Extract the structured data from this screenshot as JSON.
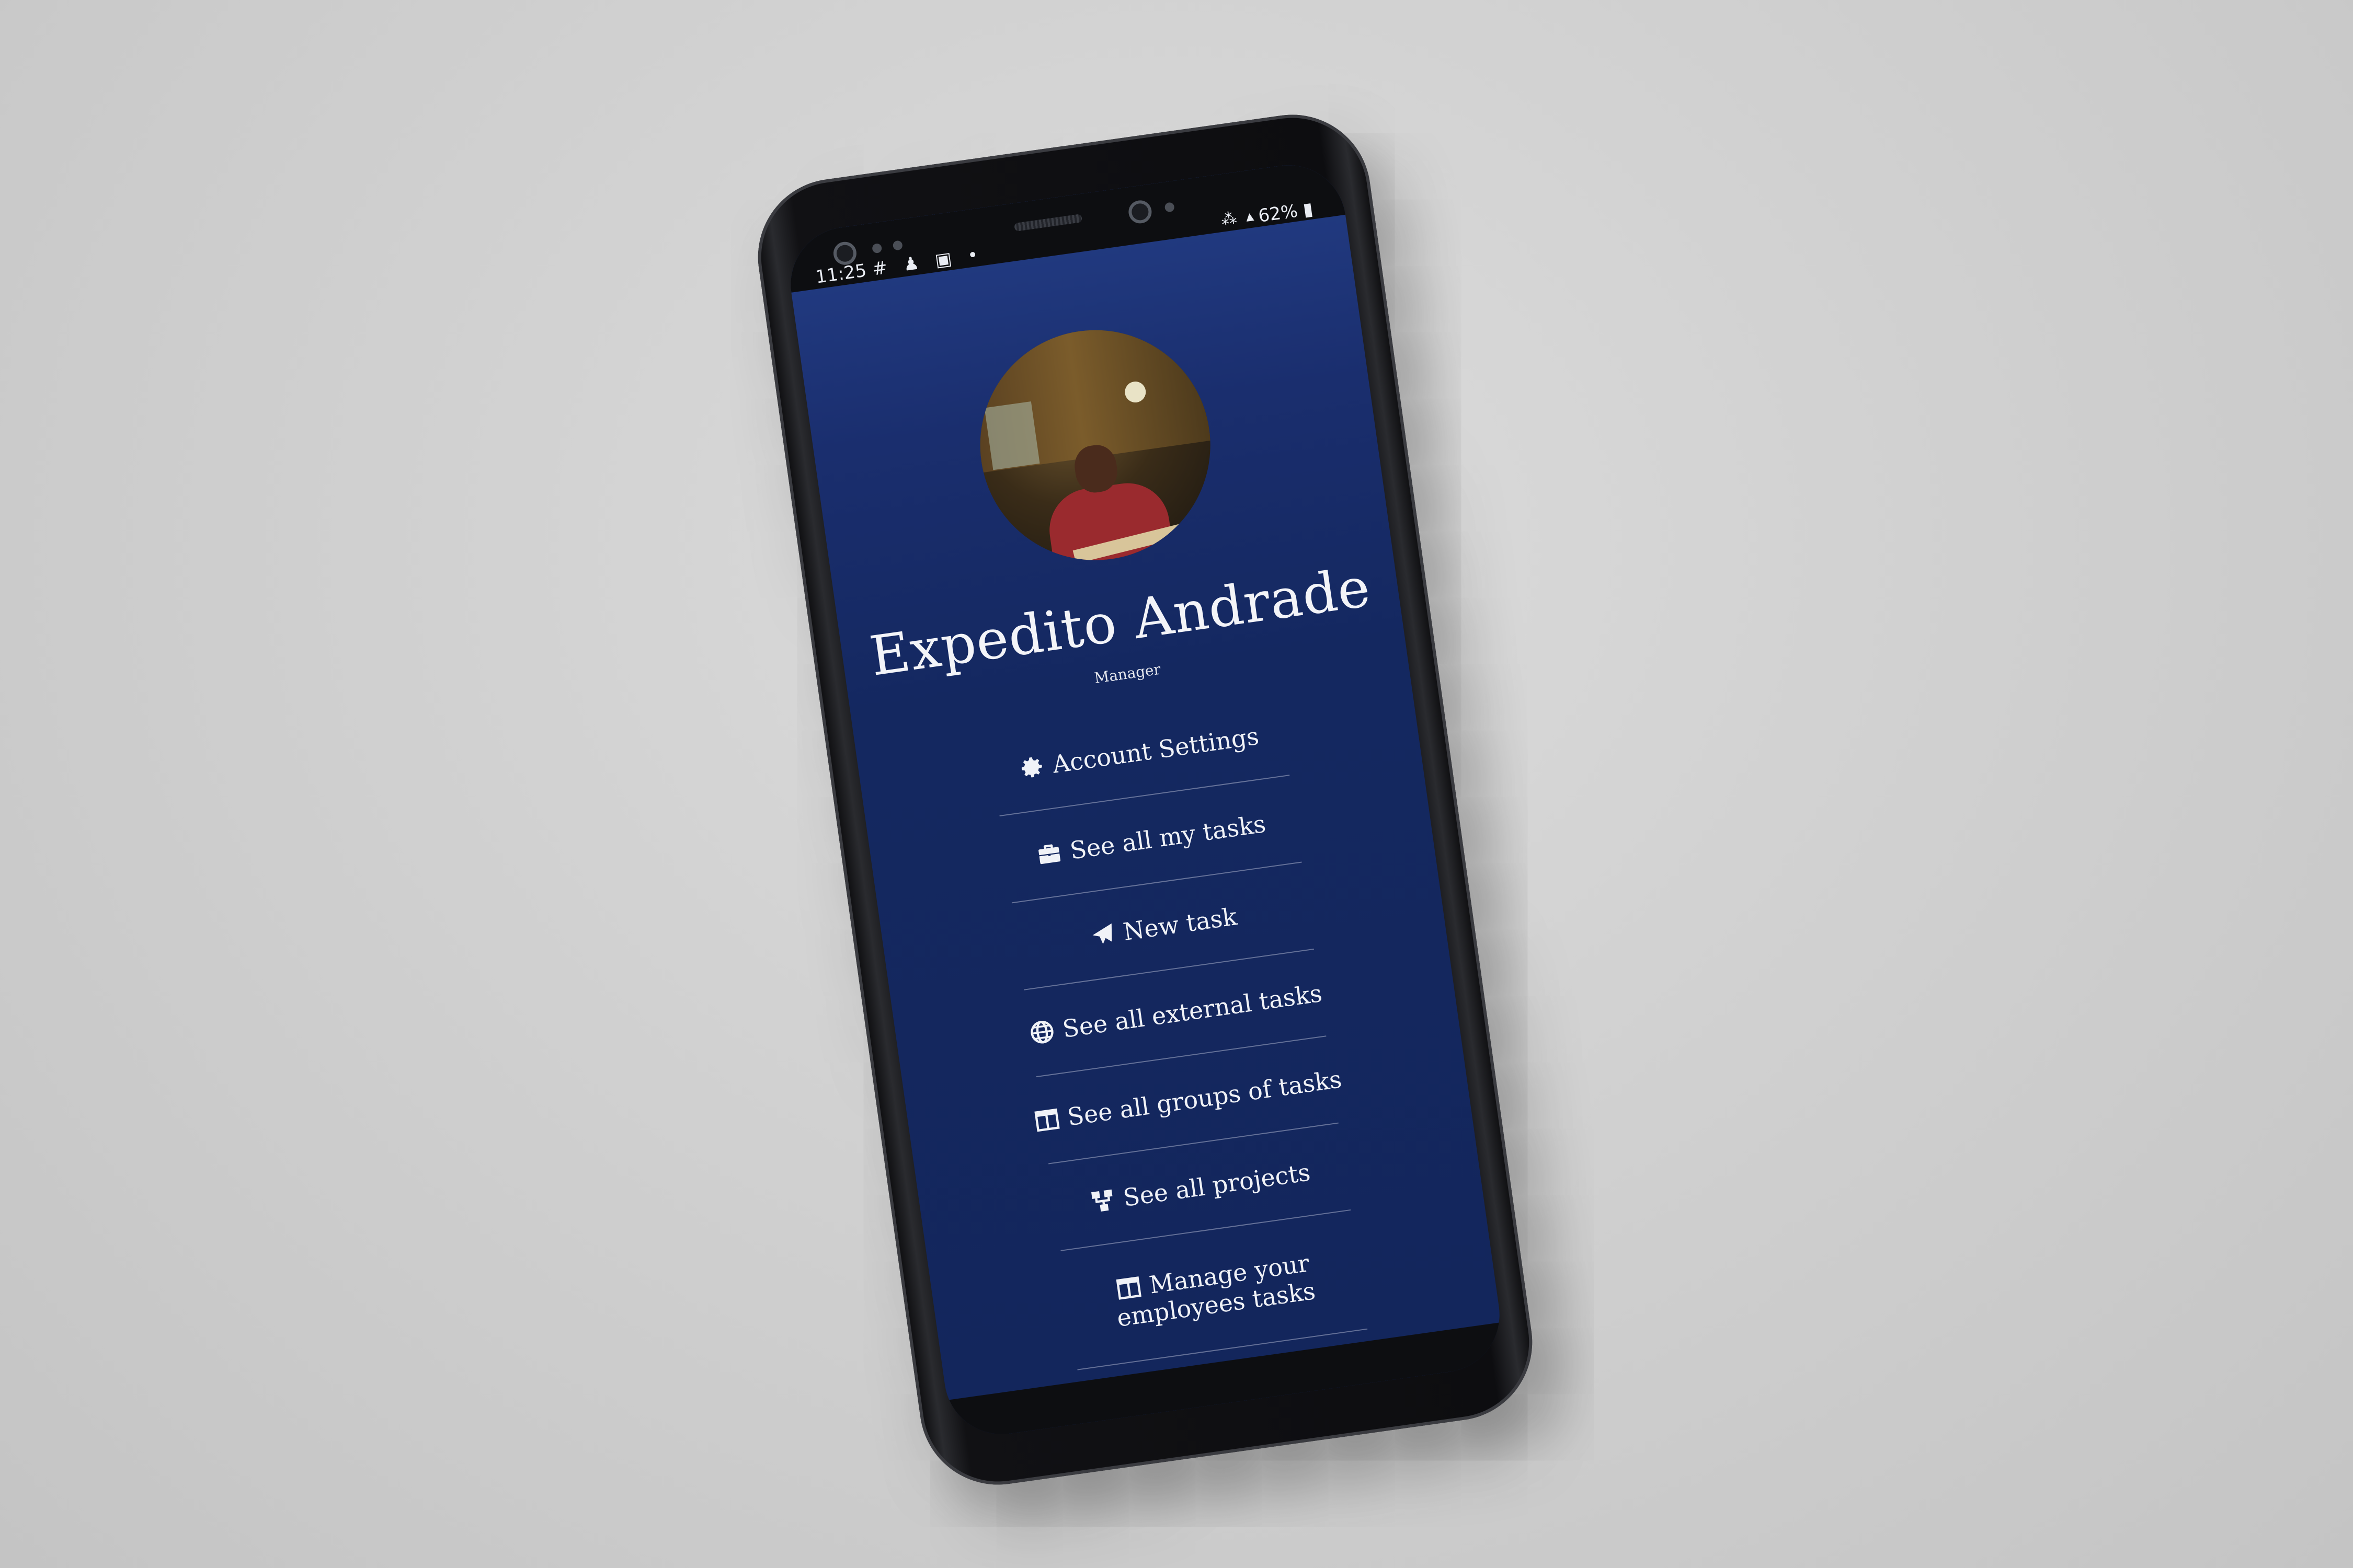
{
  "status_bar": {
    "time": "11:25",
    "left_icons": "# ♟ ▣ •",
    "signal": "⁂ ▴",
    "battery": "62% ▮"
  },
  "profile": {
    "name": "Expedito Andrade",
    "role": "Manager"
  },
  "menu": {
    "items": [
      {
        "label": "Account Settings",
        "icon": "gear-icon"
      },
      {
        "label": "See all my tasks",
        "icon": "briefcase-icon"
      },
      {
        "label": "New task",
        "icon": "paper-plane-icon"
      },
      {
        "label": "See all external tasks",
        "icon": "globe-icon"
      },
      {
        "label": "See all groups of tasks",
        "icon": "columns-icon"
      },
      {
        "label": "See all projects",
        "icon": "sitemap-icon"
      },
      {
        "label_line1": "Manage your",
        "label_line2": "employees tasks",
        "icon": "columns-icon"
      }
    ]
  },
  "colors": {
    "screen_top": "#233d85",
    "screen_bottom": "#13265c",
    "text": "#f0f2f7"
  }
}
